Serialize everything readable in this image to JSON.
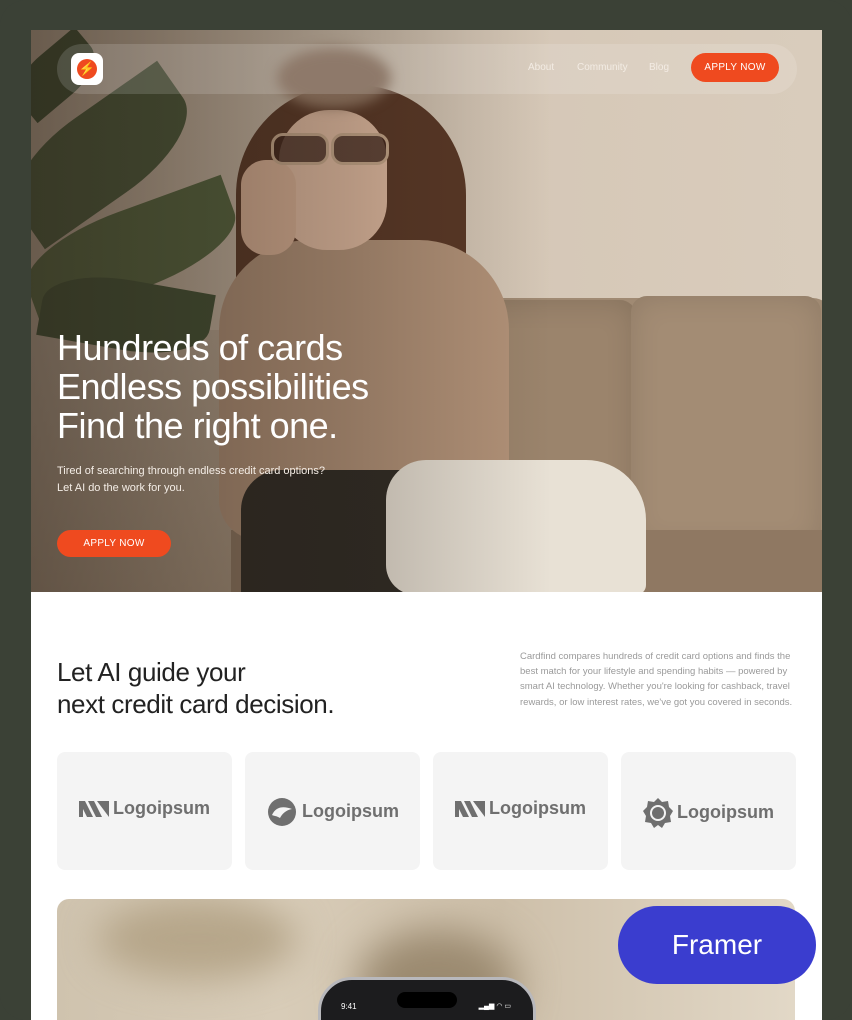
{
  "nav": {
    "links": [
      "About",
      "Community",
      "Blog"
    ],
    "cta_label": "APPLY NOW",
    "logo_icon": "lightning-bolt-icon",
    "accent_color": "#ef4a1f"
  },
  "hero": {
    "headline": [
      "Hundreds of cards",
      "Endless possibilities",
      "Find the right one."
    ],
    "subtext": [
      "Tired of searching through endless credit card options?",
      "Let AI do the work for you."
    ],
    "cta_label": "APPLY NOW"
  },
  "intro": {
    "title": [
      "Let AI guide your",
      "next credit card decision."
    ],
    "description": "Cardfind compares hundreds of credit card options and finds the best match for your lifestyle and spending habits — powered by smart AI technology. Whether you're looking for cashback, travel rewards, or low interest rates, we've got you covered in seconds."
  },
  "logos": [
    {
      "name": "Logoipsum",
      "icon": "logoipsum-stripes-icon"
    },
    {
      "name": "Logoipsum",
      "icon": "logoipsum-swirl-icon"
    },
    {
      "name": "Logoipsum",
      "icon": "logoipsum-stripes-icon"
    },
    {
      "name": "Logoipsum",
      "icon": "logoipsum-badge-icon"
    }
  ],
  "phone": {
    "time": "9:41"
  },
  "badge": {
    "label": "Framer",
    "color": "#3a3dcf"
  }
}
